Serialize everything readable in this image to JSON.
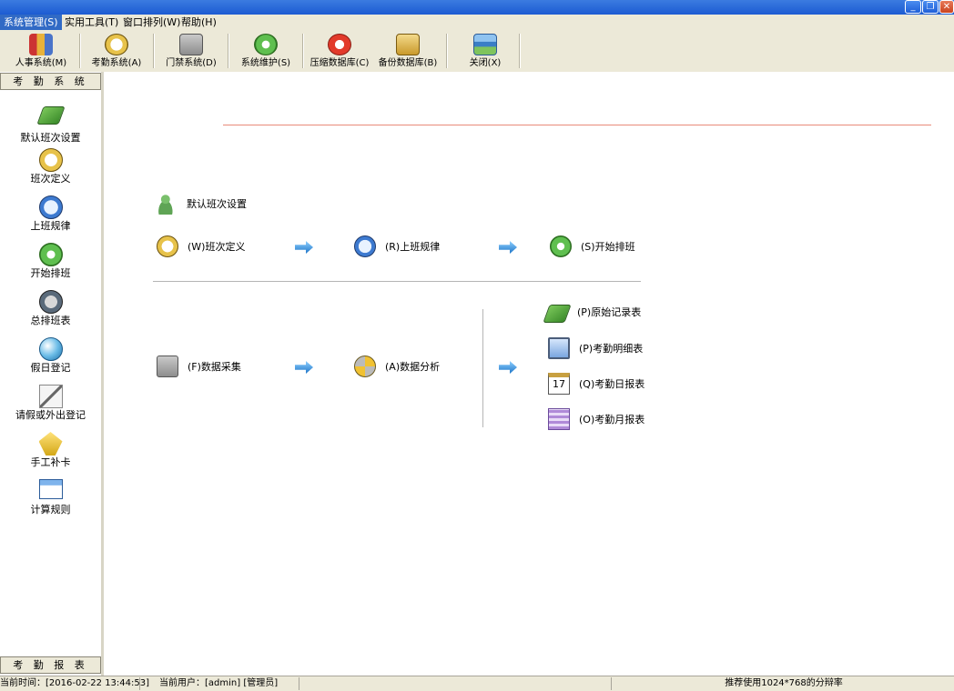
{
  "window": {
    "controls": [
      "minimize",
      "restore",
      "close"
    ]
  },
  "menubar": {
    "items": [
      {
        "label": "系统管理(S)",
        "active": true
      },
      {
        "label": "实用工具(T)",
        "active": false
      },
      {
        "label": "窗口排列(W)",
        "active": false
      },
      {
        "label": "帮助(H)",
        "active": false
      }
    ]
  },
  "toolbar": {
    "buttons": [
      {
        "label": "人事系统(M)",
        "icon": "people-icon"
      },
      {
        "label": "考勤系统(A)",
        "icon": "clock-icon"
      },
      {
        "label": "门禁系统(D)",
        "icon": "tools-icon"
      },
      {
        "label": "系统维护(S)",
        "icon": "maintenance-icon"
      },
      {
        "label": "压缩数据库(C)",
        "icon": "red-cross-icon"
      },
      {
        "label": "备份数据库(B)",
        "icon": "database-icon"
      },
      {
        "label": "关闭(X)",
        "icon": "close-window-icon"
      }
    ]
  },
  "sidebar": {
    "header": "考 勤 系 统",
    "footer": "考 勤 报 表",
    "items": [
      {
        "label": "默认班次设置",
        "icon": "book-icon"
      },
      {
        "label": "班次定义",
        "icon": "clock-icon"
      },
      {
        "label": "上班规律",
        "icon": "compass-icon"
      },
      {
        "label": "开始排班",
        "icon": "green-circle-icon"
      },
      {
        "label": "总排班表",
        "icon": "gauge-icon"
      },
      {
        "label": "假日登记",
        "icon": "globe-icon"
      },
      {
        "label": "请假或外出登记",
        "icon": "pen-icon"
      },
      {
        "label": "手工补卡",
        "icon": "nib-icon"
      },
      {
        "label": "计算规则",
        "icon": "window-icon"
      }
    ]
  },
  "main": {
    "default_shift": "默认班次设置",
    "flow1": {
      "step1": "(W)班次定义",
      "step2": "(R)上班规律",
      "step3": "(S)开始排班"
    },
    "flow2": {
      "collect": "(F)数据采集",
      "analyze": "(A)数据分析"
    },
    "reports": [
      {
        "label": "(P)原始记录表",
        "icon": "book-icon"
      },
      {
        "label": "(P)考勤明细表",
        "icon": "monitor-icon"
      },
      {
        "label": "(Q)考勤日报表",
        "icon": "calendar-icon",
        "badge": "17"
      },
      {
        "label": "(O)考勤月报表",
        "icon": "grid-icon"
      }
    ]
  },
  "statusbar": {
    "time": "当前时间：[2016-02-22 13:44:53]",
    "user": "当前用户：[admin] [管理员]",
    "blank": "",
    "resolution": "推荐使用1024*768的分辩率"
  }
}
